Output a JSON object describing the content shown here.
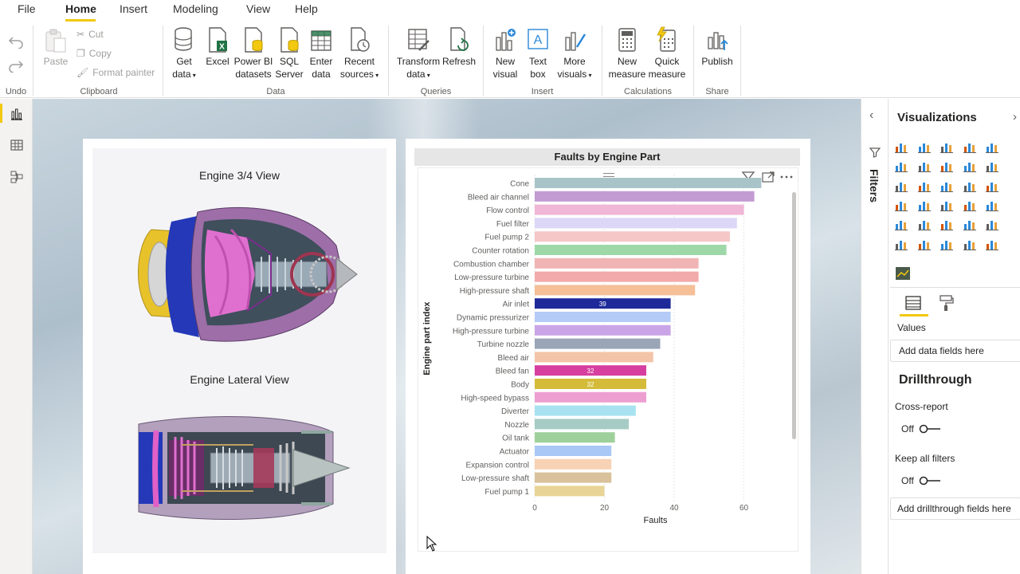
{
  "menu": {
    "items": [
      "File",
      "Home",
      "Insert",
      "Modeling",
      "View",
      "Help"
    ],
    "active": "Home"
  },
  "ribbon": {
    "undo": {
      "label": "Undo"
    },
    "clipboard": {
      "group": "Clipboard",
      "paste": "Paste",
      "cut": "Cut",
      "copy": "Copy",
      "format_painter": "Format painter"
    },
    "data": {
      "group": "Data",
      "get_data": [
        "Get",
        "data"
      ],
      "excel": "Excel",
      "pbi_datasets": [
        "Power BI",
        "datasets"
      ],
      "sql_server": [
        "SQL",
        "Server"
      ],
      "enter_data": [
        "Enter",
        "data"
      ],
      "recent_sources": [
        "Recent",
        "sources"
      ]
    },
    "queries": {
      "group": "Queries",
      "transform_data": [
        "Transform",
        "data"
      ],
      "refresh": "Refresh"
    },
    "insert": {
      "group": "Insert",
      "new_visual": [
        "New",
        "visual"
      ],
      "text_box": [
        "Text",
        "box"
      ],
      "more_visuals": [
        "More",
        "visuals"
      ]
    },
    "calculations": {
      "group": "Calculations",
      "new_measure": [
        "New",
        "measure"
      ],
      "quick_measure": [
        "Quick",
        "measure"
      ]
    },
    "share": {
      "group": "Share",
      "publish": "Publish"
    }
  },
  "report": {
    "engine_3_4_title": "Engine 3/4 View",
    "engine_lateral_title": "Engine Lateral View"
  },
  "chart_data": {
    "type": "bar",
    "orientation": "horizontal",
    "title": "Faults by Engine Part",
    "xlabel": "Faults",
    "ylabel": "Engine part index",
    "xlim": [
      0,
      72
    ],
    "xticks": [
      0,
      20,
      40,
      60
    ],
    "grid": true,
    "categories": [
      "Cone",
      "Bleed air channel",
      "Flow control",
      "Fuel filter",
      "Fuel pump 2",
      "Counter rotation",
      "Combustion chamber",
      "Low-pressure turbine",
      "High-pressure shaft",
      "Air inlet",
      "Dynamic pressurizer",
      "High-pressure turbine",
      "Turbine nozzle",
      "Bleed air",
      "Bleed fan",
      "Body",
      "High-speed bypass",
      "Diverter",
      "Nozzle",
      "Oil tank",
      "Actuator",
      "Expansion control",
      "Low-pressure shaft",
      "Fuel pump 1"
    ],
    "values": [
      65,
      63,
      60,
      58,
      56,
      55,
      47,
      47,
      46,
      39,
      39,
      39,
      36,
      34,
      32,
      32,
      32,
      29,
      27,
      23,
      22,
      22,
      22,
      20
    ],
    "colors": [
      "#a9c4c8",
      "#c39bd3",
      "#f0b7d6",
      "#dcd6f7",
      "#f5c7c7",
      "#9fd8a8",
      "#f0b4b4",
      "#f3aaaa",
      "#f5bf98",
      "#1e2a99",
      "#b5cbf7",
      "#c9a4e6",
      "#9aa5b8",
      "#f4c4a8",
      "#d63fa0",
      "#d4bc3a",
      "#ec9fd0",
      "#a8e2f0",
      "#a6cbc4",
      "#9ed09b",
      "#a9c8f5",
      "#f8d2b4",
      "#d8c19b",
      "#e8d497"
    ],
    "data_labels": [
      {
        "category": "Air inlet",
        "text": "39"
      },
      {
        "category": "Bleed fan",
        "text": "32"
      },
      {
        "category": "Body",
        "text": "32"
      }
    ]
  },
  "right_pane": {
    "filters": "Filters",
    "visualizations": "Visualizations",
    "values_label": "Values",
    "values_placeholder": "Add data fields here",
    "drillthrough": "Drillthrough",
    "cross_report": "Cross-report",
    "cross_report_state": "Off",
    "keep_all_filters": "Keep all filters",
    "keep_all_filters_state": "Off",
    "drillthrough_placeholder": "Add drillthrough fields here",
    "viz_icons": [
      "stacked-bar-icon",
      "stacked-column-icon",
      "clustered-bar-icon",
      "clustered-column-icon",
      "100-bar-icon",
      "100-column-icon",
      "line-icon",
      "area-icon",
      "stacked-area-icon",
      "line-column-icon",
      "line-stacked-column-icon",
      "ribbon-icon",
      "waterfall-icon",
      "funnel-icon",
      "scatter-icon",
      "pie-icon",
      "donut-icon",
      "treemap-icon",
      "map-icon",
      "filled-map-icon",
      "shape-map-icon",
      "gauge-icon",
      "card-icon",
      "multirow-card-icon",
      "kpi-icon",
      "slicer-icon",
      "table-icon",
      "matrix-icon",
      "r-visual-icon",
      "python-visual-icon",
      "key-influencers-icon",
      "decomposition-tree-icon",
      "qa-icon",
      "arcgis-icon",
      "power-apps-icon",
      "more-icon"
    ]
  }
}
